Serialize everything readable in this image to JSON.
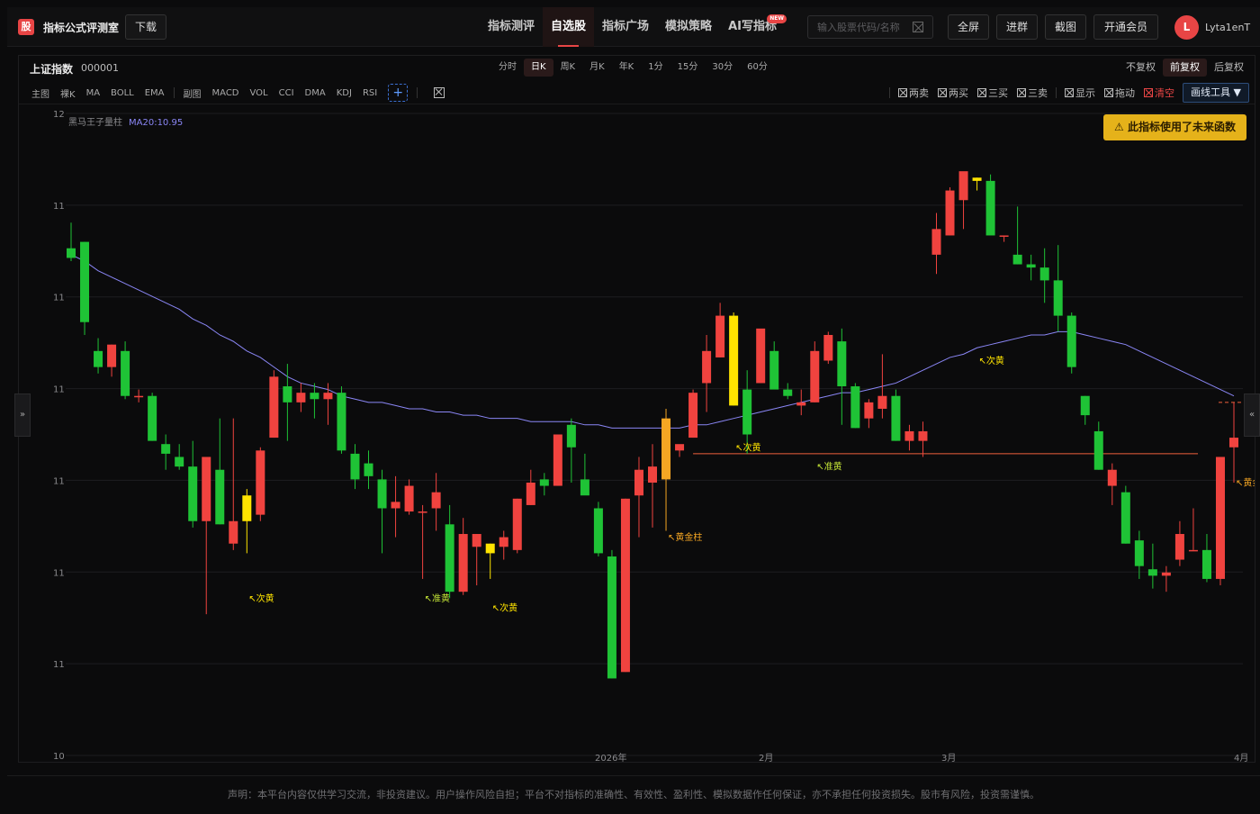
{
  "topbar": {
    "logo_text": "股",
    "app_title": "指标公式评测室",
    "download_label": "下载",
    "nav": [
      {
        "label": "指标测评"
      },
      {
        "label": "自选股",
        "active": true
      },
      {
        "label": "指标广场"
      },
      {
        "label": "模拟策略"
      },
      {
        "label": "AI写指标",
        "badge": "NEW"
      }
    ],
    "search_placeholder": "输入股票代码/名称",
    "fullscreen_label": "全屏",
    "join_group_label": "进群",
    "screenshot_label": "截图",
    "vip_label": "开通会员",
    "avatar_letter": "L",
    "username": "Lyta1enT"
  },
  "panel": {
    "symbol_name": "上证指数",
    "symbol_code": "000001",
    "periods": [
      "分时",
      "日K",
      "周K",
      "月K",
      "年K",
      "1分",
      "15分",
      "30分",
      "60分"
    ],
    "active_period": "日K",
    "adjust": [
      "不复权",
      "前复权",
      "后复权"
    ],
    "active_adjust": "前复权",
    "main_chart_items": [
      "主图",
      "裸K",
      "MA",
      "BOLL",
      "EMA"
    ],
    "sub_chart_items": [
      "副图",
      "MACD",
      "VOL",
      "CCI",
      "DMA",
      "KDJ",
      "RSI"
    ],
    "plus_label": "+",
    "right_tools": [
      "两卖",
      "两买",
      "三买",
      "三卖",
      "显示",
      "拖动",
      "清空"
    ],
    "draw_tool_label": "画线工具 ▼",
    "left_tab": "»",
    "right_tab": "«"
  },
  "warning": "⚠ 此指标使用了未来函数",
  "disclaimer": "声明：本平台内容仅供学习交流，非投资建议。用户操作风险自担；平台不对指标的准确性、有效性、盈利性、模拟数据作任何保证，亦不承担任何投资损失。股市有风险，投资需谨慎。",
  "colors": {
    "up": "#f0433f",
    "down": "#1fc336",
    "yellow": "#ffe400",
    "orange": "#f5a623",
    "ma": "#8a86f5",
    "gold_line": "#f0603c"
  },
  "chart_data": {
    "type": "candlestick",
    "indicator_name": "黑马王子量柱",
    "ma_label": "MA20:10.95",
    "y_tick_labels": [
      "12",
      "11",
      "11",
      "11",
      "11",
      "11",
      "11",
      "10"
    ],
    "x_tick_labels": [
      "2026年",
      "2月",
      "3月",
      "4月"
    ],
    "ylim": [
      10.0,
      12.0
    ],
    "candles": [
      {
        "o": 11.58,
        "h": 11.66,
        "l": 11.54,
        "c": 11.55,
        "t": "down"
      },
      {
        "o": 11.6,
        "h": 11.6,
        "l": 11.31,
        "c": 11.35,
        "t": "down"
      },
      {
        "o": 11.26,
        "h": 11.3,
        "l": 11.19,
        "c": 11.21,
        "t": "down"
      },
      {
        "o": 11.21,
        "h": 11.28,
        "l": 11.18,
        "c": 11.28,
        "t": "up"
      },
      {
        "o": 11.26,
        "h": 11.29,
        "l": 11.11,
        "c": 11.12,
        "t": "down"
      },
      {
        "o": 11.12,
        "h": 11.14,
        "l": 11.1,
        "c": 11.12,
        "t": "up"
      },
      {
        "o": 11.12,
        "h": 11.13,
        "l": 10.98,
        "c": 10.98,
        "t": "down"
      },
      {
        "o": 10.97,
        "h": 11.0,
        "l": 10.89,
        "c": 10.94,
        "t": "down"
      },
      {
        "o": 10.93,
        "h": 10.97,
        "l": 10.89,
        "c": 10.9,
        "t": "down"
      },
      {
        "o": 10.9,
        "h": 10.98,
        "l": 10.71,
        "c": 10.73,
        "t": "down"
      },
      {
        "o": 10.73,
        "h": 10.93,
        "l": 10.44,
        "c": 10.93,
        "t": "up"
      },
      {
        "o": 10.89,
        "h": 11.05,
        "l": 10.72,
        "c": 10.72,
        "t": "down"
      },
      {
        "o": 10.66,
        "h": 11.05,
        "l": 10.64,
        "c": 10.73,
        "t": "up"
      },
      {
        "o": 10.73,
        "h": 10.83,
        "l": 10.63,
        "c": 10.81,
        "t": "yellow"
      },
      {
        "o": 10.75,
        "h": 10.96,
        "l": 10.73,
        "c": 10.95,
        "t": "up"
      },
      {
        "o": 10.99,
        "h": 11.2,
        "l": 10.99,
        "c": 11.18,
        "t": "up"
      },
      {
        "o": 11.15,
        "h": 11.22,
        "l": 10.98,
        "c": 11.1,
        "t": "down"
      },
      {
        "o": 11.1,
        "h": 11.16,
        "l": 11.07,
        "c": 11.13,
        "t": "up"
      },
      {
        "o": 11.13,
        "h": 11.16,
        "l": 11.05,
        "c": 11.11,
        "t": "down"
      },
      {
        "o": 11.11,
        "h": 11.16,
        "l": 11.03,
        "c": 11.13,
        "t": "up"
      },
      {
        "o": 11.13,
        "h": 11.15,
        "l": 10.94,
        "c": 10.95,
        "t": "down"
      },
      {
        "o": 10.94,
        "h": 10.97,
        "l": 10.83,
        "c": 10.86,
        "t": "down"
      },
      {
        "o": 10.91,
        "h": 10.95,
        "l": 10.83,
        "c": 10.87,
        "t": "down"
      },
      {
        "o": 10.86,
        "h": 10.89,
        "l": 10.63,
        "c": 10.77,
        "t": "down"
      },
      {
        "o": 10.77,
        "h": 10.87,
        "l": 10.68,
        "c": 10.79,
        "t": "up"
      },
      {
        "o": 10.76,
        "h": 10.86,
        "l": 10.75,
        "c": 10.84,
        "t": "up"
      },
      {
        "o": 10.76,
        "h": 10.78,
        "l": 10.55,
        "c": 10.76,
        "t": "up"
      },
      {
        "o": 10.77,
        "h": 10.88,
        "l": 10.7,
        "c": 10.82,
        "t": "up"
      },
      {
        "o": 10.72,
        "h": 10.78,
        "l": 10.49,
        "c": 10.51,
        "t": "down"
      },
      {
        "o": 10.51,
        "h": 10.74,
        "l": 10.5,
        "c": 10.69,
        "t": "up"
      },
      {
        "o": 10.65,
        "h": 10.69,
        "l": 10.53,
        "c": 10.69,
        "t": "up"
      },
      {
        "o": 10.63,
        "h": 10.66,
        "l": 10.55,
        "c": 10.66,
        "t": "yellow"
      },
      {
        "o": 10.65,
        "h": 10.7,
        "l": 10.61,
        "c": 10.68,
        "t": "up"
      },
      {
        "o": 10.64,
        "h": 10.8,
        "l": 10.63,
        "c": 10.8,
        "t": "up"
      },
      {
        "o": 10.78,
        "h": 10.89,
        "l": 10.78,
        "c": 10.85,
        "t": "up"
      },
      {
        "o": 10.84,
        "h": 10.88,
        "l": 10.81,
        "c": 10.86,
        "t": "down"
      },
      {
        "o": 10.84,
        "h": 11.0,
        "l": 10.84,
        "c": 11.0,
        "t": "up"
      },
      {
        "o": 11.03,
        "h": 11.05,
        "l": 10.85,
        "c": 10.96,
        "t": "down"
      },
      {
        "o": 10.86,
        "h": 10.94,
        "l": 10.82,
        "c": 10.81,
        "t": "down"
      },
      {
        "o": 10.77,
        "h": 10.79,
        "l": 10.62,
        "c": 10.63,
        "t": "down"
      },
      {
        "o": 10.62,
        "h": 10.64,
        "l": 10.24,
        "c": 10.24,
        "t": "down"
      },
      {
        "o": 10.26,
        "h": 10.8,
        "l": 10.26,
        "c": 10.8,
        "t": "up"
      },
      {
        "o": 10.81,
        "h": 10.93,
        "l": 10.68,
        "c": 10.89,
        "t": "up"
      },
      {
        "o": 10.85,
        "h": 10.97,
        "l": 10.71,
        "c": 10.9,
        "t": "up"
      },
      {
        "o": 10.86,
        "h": 11.08,
        "l": 10.7,
        "c": 11.05,
        "t": "orange"
      },
      {
        "o": 10.95,
        "h": 10.96,
        "l": 10.93,
        "c": 10.97,
        "t": "up"
      },
      {
        "o": 10.99,
        "h": 11.14,
        "l": 10.99,
        "c": 11.13,
        "t": "up"
      },
      {
        "o": 11.16,
        "h": 11.31,
        "l": 11.07,
        "c": 11.26,
        "t": "up"
      },
      {
        "o": 11.24,
        "h": 11.41,
        "l": 11.24,
        "c": 11.37,
        "t": "up"
      },
      {
        "o": 11.37,
        "h": 11.38,
        "l": 11.09,
        "c": 11.09,
        "t": "yellow"
      },
      {
        "o": 11.14,
        "h": 11.2,
        "l": 10.94,
        "c": 11.0,
        "t": "down"
      },
      {
        "o": 11.16,
        "h": 11.28,
        "l": 11.16,
        "c": 11.33,
        "t": "up"
      },
      {
        "o": 11.26,
        "h": 11.29,
        "l": 11.15,
        "c": 11.14,
        "t": "down"
      },
      {
        "o": 11.14,
        "h": 11.16,
        "l": 11.11,
        "c": 11.12,
        "t": "down"
      },
      {
        "o": 11.09,
        "h": 11.14,
        "l": 11.06,
        "c": 11.1,
        "t": "up"
      },
      {
        "o": 11.1,
        "h": 11.29,
        "l": 11.1,
        "c": 11.26,
        "t": "up"
      },
      {
        "o": 11.23,
        "h": 11.32,
        "l": 11.22,
        "c": 11.31,
        "t": "up"
      },
      {
        "o": 11.29,
        "h": 11.33,
        "l": 11.03,
        "c": 11.15,
        "t": "down"
      },
      {
        "o": 11.15,
        "h": 11.16,
        "l": 11.02,
        "c": 11.02,
        "t": "down"
      },
      {
        "o": 11.05,
        "h": 11.11,
        "l": 11.02,
        "c": 11.1,
        "t": "up"
      },
      {
        "o": 11.08,
        "h": 11.25,
        "l": 11.05,
        "c": 11.12,
        "t": "up"
      },
      {
        "o": 11.12,
        "h": 11.14,
        "l": 10.98,
        "c": 10.98,
        "t": "down"
      },
      {
        "o": 10.98,
        "h": 11.03,
        "l": 10.95,
        "c": 11.01,
        "t": "up"
      },
      {
        "o": 10.98,
        "h": 11.04,
        "l": 10.93,
        "c": 11.01,
        "t": "up"
      },
      {
        "o": 11.56,
        "h": 11.69,
        "l": 11.5,
        "c": 11.64,
        "t": "up"
      },
      {
        "o": 11.62,
        "h": 11.77,
        "l": 11.62,
        "c": 11.76,
        "t": "up"
      },
      {
        "o": 11.73,
        "h": 11.79,
        "l": 11.64,
        "c": 11.82,
        "t": "up"
      },
      {
        "o": 11.79,
        "h": 11.8,
        "l": 11.76,
        "c": 11.8,
        "t": "yellow"
      },
      {
        "o": 11.79,
        "h": 11.81,
        "l": 11.63,
        "c": 11.62,
        "t": "down"
      },
      {
        "o": 11.62,
        "h": 11.62,
        "l": 11.6,
        "c": 11.62,
        "t": "up"
      },
      {
        "o": 11.56,
        "h": 11.71,
        "l": 11.53,
        "c": 11.53,
        "t": "down"
      },
      {
        "o": 11.53,
        "h": 11.56,
        "l": 11.48,
        "c": 11.52,
        "t": "down"
      },
      {
        "o": 11.52,
        "h": 11.58,
        "l": 11.41,
        "c": 11.48,
        "t": "down"
      },
      {
        "o": 11.48,
        "h": 11.59,
        "l": 11.32,
        "c": 11.37,
        "t": "down"
      },
      {
        "o": 11.37,
        "h": 11.38,
        "l": 11.19,
        "c": 11.21,
        "t": "down"
      },
      {
        "o": 11.12,
        "h": 11.12,
        "l": 11.03,
        "c": 11.06,
        "t": "down"
      },
      {
        "o": 11.01,
        "h": 11.04,
        "l": 10.89,
        "c": 10.89,
        "t": "down"
      },
      {
        "o": 10.89,
        "h": 10.91,
        "l": 10.78,
        "c": 10.84,
        "t": "up"
      },
      {
        "o": 10.82,
        "h": 10.84,
        "l": 10.66,
        "c": 10.66,
        "t": "down"
      },
      {
        "o": 10.67,
        "h": 10.7,
        "l": 10.55,
        "c": 10.59,
        "t": "down"
      },
      {
        "o": 10.58,
        "h": 10.66,
        "l": 10.52,
        "c": 10.56,
        "t": "down"
      },
      {
        "o": 10.57,
        "h": 10.59,
        "l": 10.51,
        "c": 10.56,
        "t": "up"
      },
      {
        "o": 10.61,
        "h": 10.73,
        "l": 10.59,
        "c": 10.69,
        "t": "up"
      },
      {
        "o": 10.64,
        "h": 10.77,
        "l": 10.64,
        "c": 10.64,
        "t": "up"
      },
      {
        "o": 10.64,
        "h": 10.69,
        "l": 10.54,
        "c": 10.55,
        "t": "down"
      },
      {
        "o": 10.55,
        "h": 10.93,
        "l": 10.53,
        "c": 10.93,
        "t": "up"
      },
      {
        "o": 10.99,
        "h": 11.1,
        "l": 10.85,
        "c": 10.96,
        "t": "up"
      }
    ],
    "ma20": [
      11.56,
      11.54,
      11.51,
      11.49,
      11.47,
      11.45,
      11.43,
      11.41,
      11.39,
      11.36,
      11.34,
      11.31,
      11.29,
      11.26,
      11.24,
      11.21,
      11.18,
      11.16,
      11.15,
      11.14,
      11.12,
      11.11,
      11.1,
      11.1,
      11.09,
      11.08,
      11.08,
      11.07,
      11.07,
      11.06,
      11.06,
      11.05,
      11.05,
      11.05,
      11.04,
      11.04,
      11.04,
      11.04,
      11.03,
      11.03,
      11.02,
      11.02,
      11.02,
      11.02,
      11.02,
      11.02,
      11.03,
      11.03,
      11.04,
      11.05,
      11.06,
      11.07,
      11.08,
      11.09,
      11.1,
      11.11,
      11.12,
      11.13,
      11.13,
      11.14,
      11.15,
      11.16,
      11.18,
      11.2,
      11.22,
      11.24,
      11.25,
      11.27,
      11.28,
      11.29,
      11.3,
      11.31,
      11.31,
      11.32,
      11.32,
      11.31,
      11.3,
      11.29,
      11.28,
      11.26,
      11.24,
      11.22,
      11.2,
      11.18,
      11.16,
      11.14,
      11.12
    ],
    "annotations": [
      {
        "text": "↖次黄",
        "index": 13,
        "y": 10.48,
        "color": "#ffe400"
      },
      {
        "text": "↖准黄",
        "index": 26,
        "y": 10.48,
        "color": "#c5e637"
      },
      {
        "text": "↖次黄",
        "index": 31,
        "y": 10.45,
        "color": "#ffe400"
      },
      {
        "text": "↖黄金柱",
        "index": 44,
        "y": 10.67,
        "color": "#f5a623"
      },
      {
        "text": "↖次黄",
        "index": 49,
        "y": 10.95,
        "color": "#ffe400"
      },
      {
        "text": "↖准黄",
        "index": 55,
        "y": 10.89,
        "color": "#c5e637"
      },
      {
        "text": "↖次黄",
        "index": 67,
        "y": 11.22,
        "color": "#ffe400"
      },
      {
        "text": "↖黄金柱",
        "index": 86,
        "y": 10.84,
        "color": "#f5a623"
      }
    ],
    "gold_line_level": 10.94,
    "gold_line_start_index": 46
  }
}
